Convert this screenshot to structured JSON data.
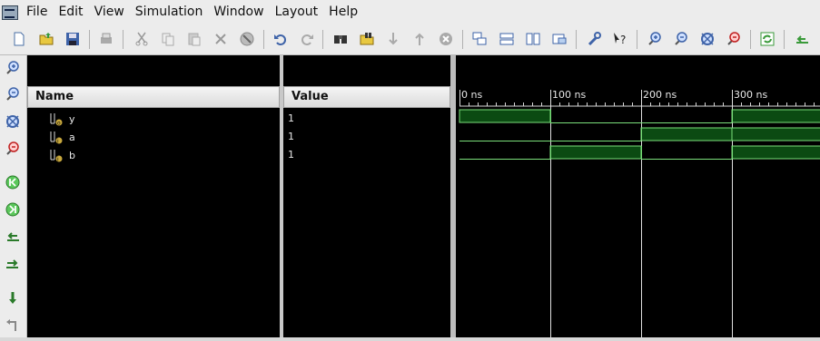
{
  "menu": [
    "File",
    "Edit",
    "View",
    "Simulation",
    "Window",
    "Layout",
    "Help"
  ],
  "columns": {
    "name": "Name",
    "value": "Value"
  },
  "signals": [
    {
      "name": "y",
      "value": "1",
      "kind": "output"
    },
    {
      "name": "a",
      "value": "1",
      "kind": "input"
    },
    {
      "name": "b",
      "value": "1",
      "kind": "input"
    }
  ],
  "time_axis": {
    "unit": "ns",
    "labels": [
      "0 ns",
      "100 ns",
      "200 ns",
      "300 ns"
    ]
  },
  "waveforms": {
    "y": [
      1,
      0,
      0,
      1
    ],
    "a": [
      0,
      0,
      1,
      1
    ],
    "b": [
      0,
      1,
      0,
      1
    ]
  },
  "colors": {
    "wave": "#7be07b",
    "wave_fill": "#0b4a12",
    "cursor": "#e0e0e0",
    "background": "#000000"
  }
}
